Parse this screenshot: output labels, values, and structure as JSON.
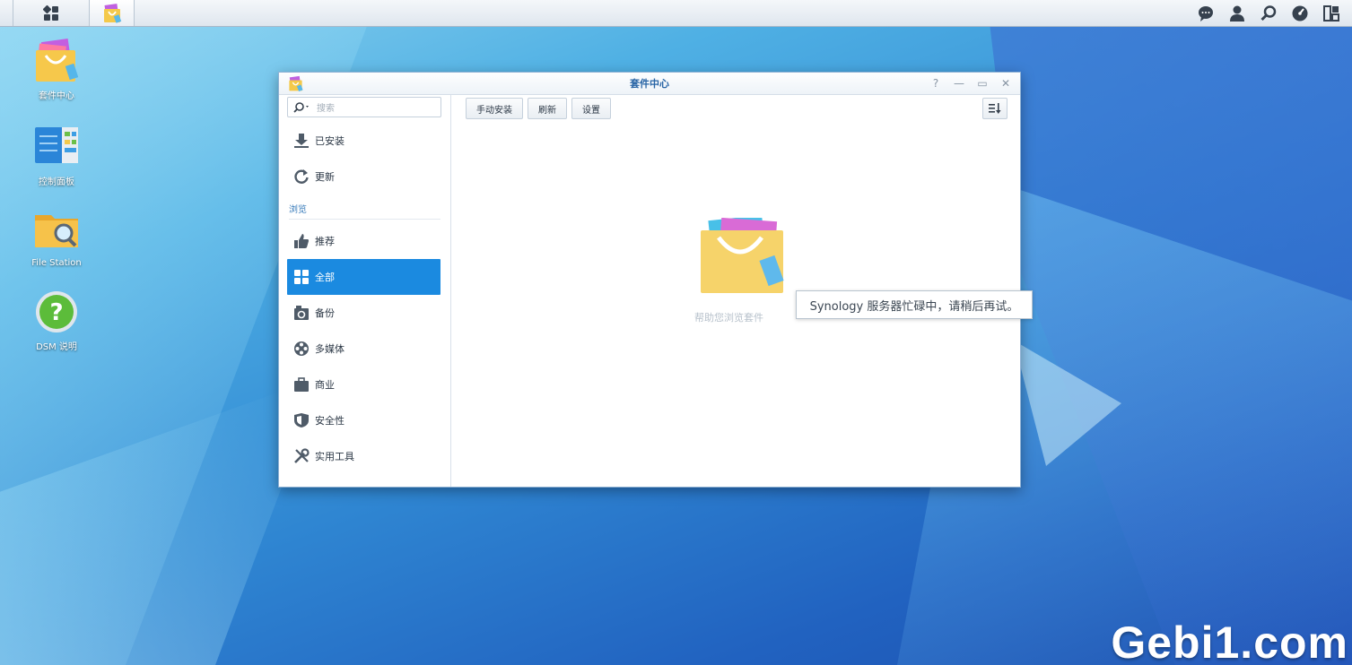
{
  "desktop": {
    "icons": [
      {
        "label": "套件中心"
      },
      {
        "label": "控制面板"
      },
      {
        "label": "File Station"
      },
      {
        "label": "DSM 说明"
      }
    ]
  },
  "window": {
    "title": "套件中心",
    "controls": {
      "help": "?",
      "minimize": "—",
      "maximize": "▭",
      "close": "✕"
    }
  },
  "sidebar": {
    "search_placeholder": "搜索",
    "items_top": [
      {
        "label": "已安装",
        "icon": "download-icon"
      },
      {
        "label": "更新",
        "icon": "refresh-icon"
      }
    ],
    "section_label": "浏览",
    "items_browse": [
      {
        "label": "推荐",
        "icon": "thumbs-up-icon"
      },
      {
        "label": "全部",
        "icon": "grid-icon"
      },
      {
        "label": "备份",
        "icon": "backup-icon"
      },
      {
        "label": "多媒体",
        "icon": "film-reel-icon"
      },
      {
        "label": "商业",
        "icon": "briefcase-icon"
      },
      {
        "label": "安全性",
        "icon": "shield-icon"
      },
      {
        "label": "实用工具",
        "icon": "tools-icon"
      }
    ]
  },
  "toolbar": {
    "manual_install": "手动安装",
    "refresh": "刷新",
    "settings": "设置"
  },
  "main": {
    "toast": "Synology 服务器忙碌中，请稍后再试。",
    "empty_text": "帮助您浏览套件"
  },
  "watermark": "Gebi1.com",
  "colors": {
    "accent": "#1b8ae0",
    "title": "#2764a5"
  }
}
